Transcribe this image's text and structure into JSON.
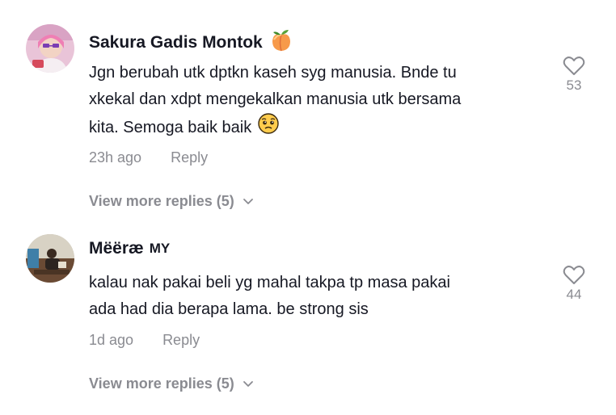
{
  "comments": [
    {
      "username": "Sakura Gadis Montok",
      "username_emoji": "peach-emoji",
      "region_tag": "",
      "text_lines": [
        "Jgn berubah utk dptkn kaseh syg manusia. Bnde tu",
        "xkekal dan xdpt mengekalkan manusia utk bersama",
        "kita. Semoga baik baik"
      ],
      "text_emoji": "pleading-face-emoji",
      "time": "23h ago",
      "reply_label": "Reply",
      "like_icon": "heart-outline-icon",
      "like_count": "53",
      "view_more": "View more replies (5)"
    },
    {
      "username": "Mëëræ",
      "username_emoji": "",
      "region_tag": "MY",
      "text_lines": [
        "kalau nak pakai beli yg mahal takpa tp masa pakai",
        "ada had dia berapa lama. be strong sis"
      ],
      "text_emoji": "",
      "time": "1d ago",
      "reply_label": "Reply",
      "like_icon": "heart-outline-icon",
      "like_count": "44",
      "view_more": "View more replies (5)"
    }
  ],
  "colors": {
    "primary_text": "#161823",
    "secondary_text": "#8a8b91"
  }
}
